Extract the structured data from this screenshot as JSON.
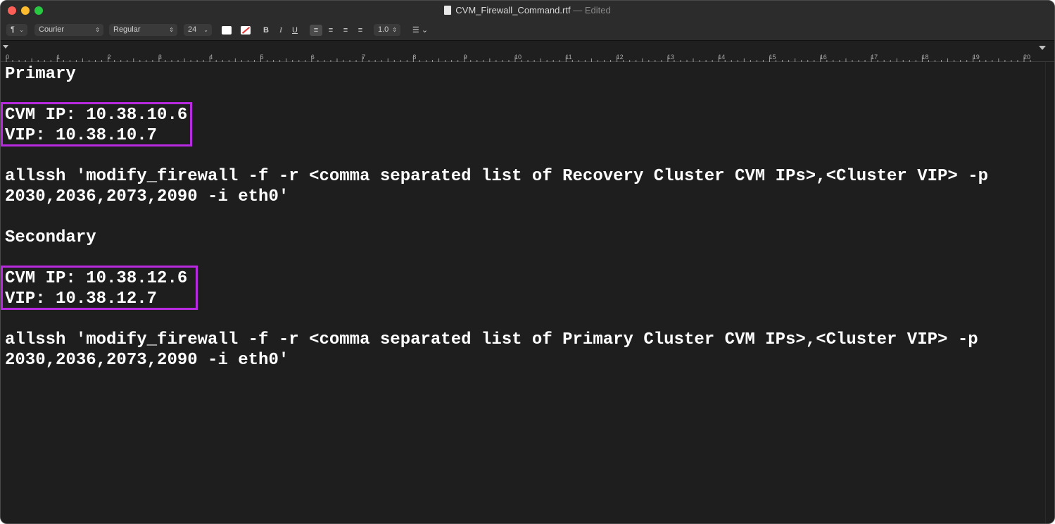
{
  "window": {
    "title": "CVM_Firewall_Command.rtf",
    "separator": "—",
    "status": "Edited"
  },
  "toolbar": {
    "paragraph_style": "¶",
    "font_family": "Courier",
    "font_style": "Regular",
    "font_size": "24",
    "bold": "B",
    "italic": "I",
    "underline": "U",
    "line_spacing": "1.0"
  },
  "ruler": {
    "ticks": [
      "0",
      "1",
      "2",
      "3",
      "4",
      "5",
      "6",
      "7",
      "8",
      "9",
      "10",
      "11",
      "12",
      "13",
      "14",
      "15",
      "16",
      "17",
      "18",
      "19",
      "20"
    ]
  },
  "document": {
    "primary_heading": "Primary",
    "primary_cvm_ip": "CVM IP: 10.38.10.6",
    "primary_vip": "VIP: 10.38.10.7",
    "primary_cmd_line1": "allssh 'modify_firewall -f -r <comma separated list of Recovery Cluster CVM IPs>,<Cluster VIP> -p",
    "primary_cmd_line2": "2030,2036,2073,2090 -i eth0'",
    "secondary_heading": "Secondary",
    "secondary_cvm_ip": "CVM IP: 10.38.12.6",
    "secondary_vip": "VIP: 10.38.12.7",
    "secondary_cmd_line1": "allssh 'modify_firewall -f -r <comma separated list of Primary Cluster CVM IPs>,<Cluster VIP> -p",
    "secondary_cmd_line2": "2030,2036,2073,2090 -i eth0'"
  },
  "colors": {
    "highlight_box": "#b82ae0",
    "background": "#1e1e1e",
    "text": "#ffffff"
  }
}
